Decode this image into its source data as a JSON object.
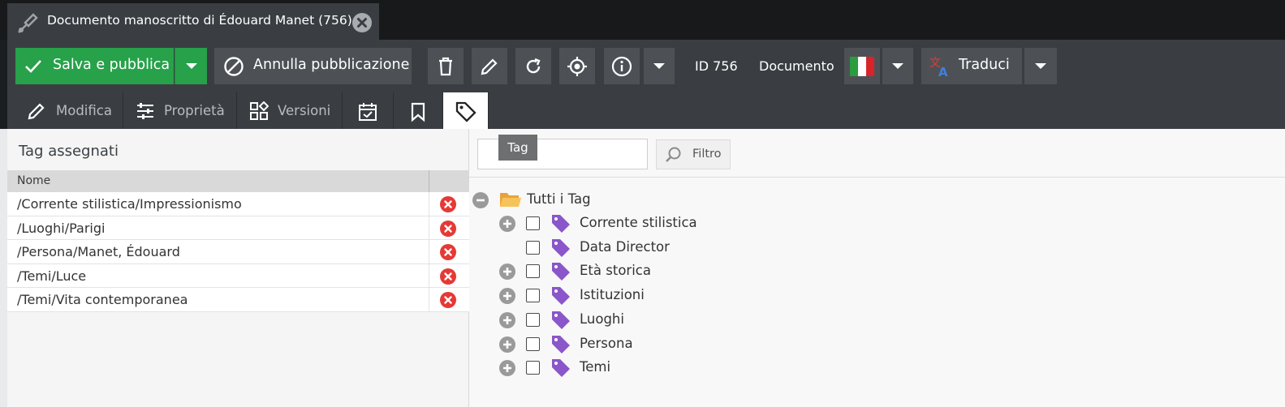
{
  "tab": {
    "title": "Documento manoscritto di Édouard Manet (756)",
    "icon": "feather-pen-icon",
    "close_icon": "close-circle-icon"
  },
  "toolbar": {
    "save_publish_label": "Salva e pubblica",
    "unpublish_label": "Annulla pubblicazione",
    "id_label": "ID 756",
    "type_label": "Documento",
    "translate_label": "Traduci",
    "language_flag": "italy-flag-icon",
    "accent_green": "#27a14a"
  },
  "subtabs": {
    "edit_label": "Modifica",
    "properties_label": "Proprietà",
    "versions_label": "Versioni",
    "active": "tags"
  },
  "left_pane": {
    "title": "Tag assegnati",
    "column_name": "Nome",
    "rows": [
      "/Corrente stilistica/Impressionismo",
      "/Luoghi/Parigi",
      "/Persona/Manet, Édouard",
      "/Temi/Luce",
      "/Temi/Vita contemporanea"
    ]
  },
  "right_pane": {
    "filter_placeholder": "",
    "filter_label": "Filtro",
    "tooltip": "Tag",
    "root_label": "Tutti i Tag",
    "tree_items": [
      {
        "label": "Corrente stilistica",
        "expandable": true
      },
      {
        "label": "Data Director",
        "expandable": false
      },
      {
        "label": "Età storica",
        "expandable": true
      },
      {
        "label": "Istituzioni",
        "expandable": true
      },
      {
        "label": "Luoghi",
        "expandable": true
      },
      {
        "label": "Persona",
        "expandable": true
      },
      {
        "label": "Temi",
        "expandable": true
      }
    ],
    "tag_color": "#8a56c9"
  }
}
